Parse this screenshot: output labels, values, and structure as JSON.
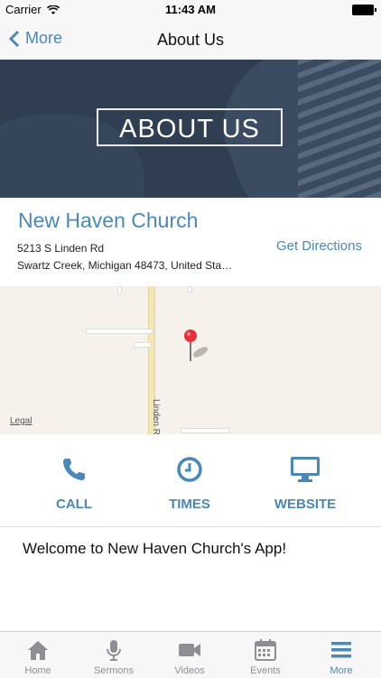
{
  "status_bar": {
    "carrier": "Carrier",
    "time": "11:43 AM"
  },
  "nav": {
    "back_label": "More",
    "title": "About Us"
  },
  "hero": {
    "label": "ABOUT US"
  },
  "church": {
    "name": "New Haven Church",
    "address_line1": "5213 S Linden Rd",
    "address_line2": "Swartz Creek, Michigan 48473, United Sta…",
    "directions_label": "Get Directions"
  },
  "map": {
    "street_label": "Linden Ro",
    "legal_label": "Legal"
  },
  "actions": {
    "call": "CALL",
    "times": "TIMES",
    "website": "WEBSITE"
  },
  "welcome": "Welcome to New Haven Church's App!",
  "tabs": [
    {
      "label": "Home"
    },
    {
      "label": "Sermons"
    },
    {
      "label": "Videos"
    },
    {
      "label": "Events"
    },
    {
      "label": "More"
    }
  ],
  "colors": {
    "accent": "#4a88b8",
    "hero_bg": "#2f3e50",
    "tab_inactive": "#8e8e93",
    "pin": "#e8303a"
  }
}
